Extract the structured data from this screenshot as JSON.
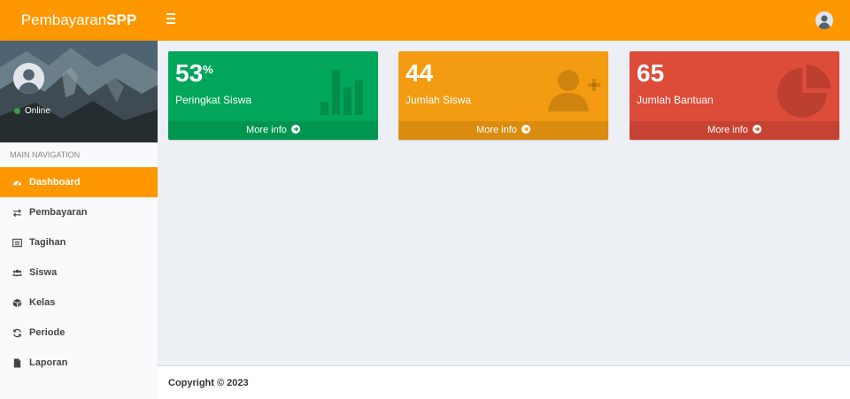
{
  "brand": {
    "light": "Pembayaran",
    "bold": "SPP"
  },
  "user": {
    "status": "Online"
  },
  "sidebar": {
    "header": "MAIN NAVIGATION",
    "items": [
      {
        "label": "Dashboard",
        "icon": "dashboard-icon",
        "active": true
      },
      {
        "label": "Pembayaran",
        "icon": "exchange-icon"
      },
      {
        "label": "Tagihan",
        "icon": "list-alt-icon"
      },
      {
        "label": "Siswa",
        "icon": "users-icon"
      },
      {
        "label": "Kelas",
        "icon": "cube-icon"
      },
      {
        "label": "Periode",
        "icon": "refresh-icon"
      },
      {
        "label": "Laporan",
        "icon": "file-icon"
      }
    ]
  },
  "boxes": [
    {
      "value": "53",
      "suffix": "%",
      "label": "Peringkat Siswa",
      "more": "More info",
      "color": "#00a65a",
      "icon": "bar-chart-icon"
    },
    {
      "value": "44",
      "label": "Jumlah Siswa",
      "more": "More info",
      "color": "#f39c12",
      "icon": "user-add-icon"
    },
    {
      "value": "65",
      "label": "Jumlah Bantuan",
      "more": "More info",
      "color": "#dd4b39",
      "icon": "pie-chart-icon"
    }
  ],
  "footer": {
    "copyright": "Copyright © 2023"
  },
  "colors": {
    "accent": "#ff9800",
    "green": "#00a65a",
    "yellow": "#f39c12",
    "red": "#dd4b39"
  }
}
